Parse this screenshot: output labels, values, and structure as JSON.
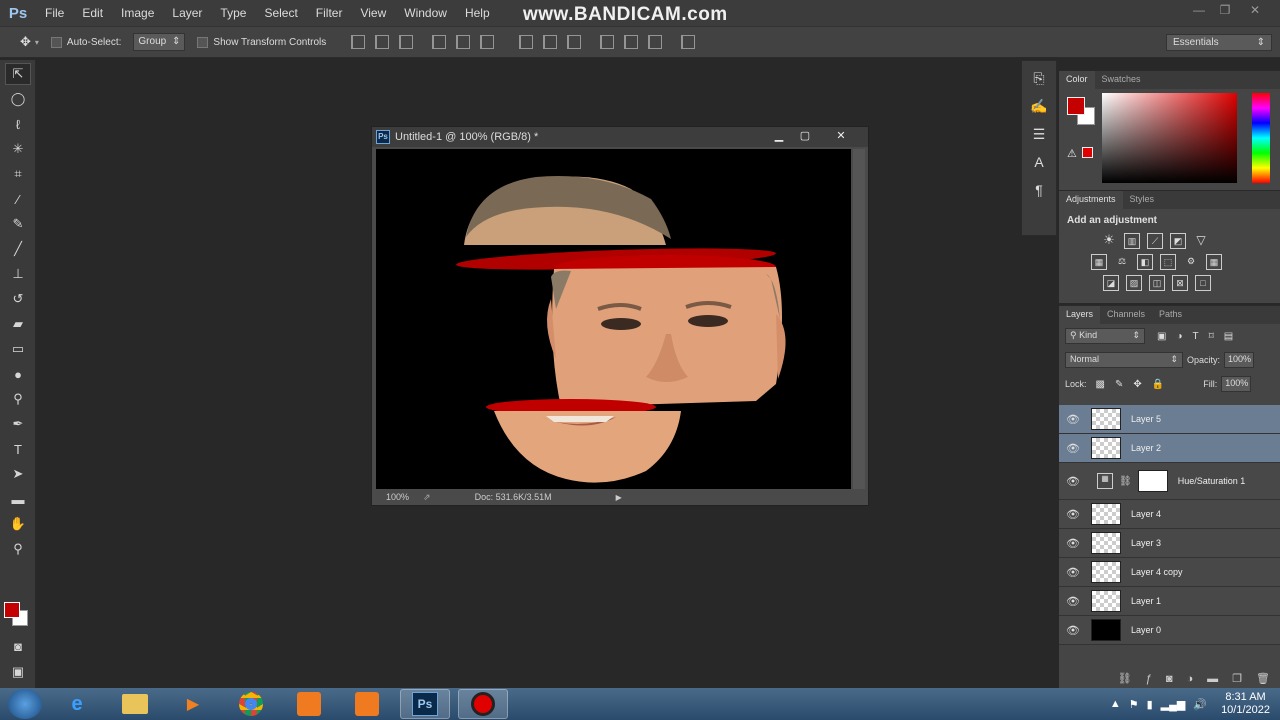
{
  "app": {
    "logo": "Ps",
    "menu": [
      "File",
      "Edit",
      "Image",
      "Layer",
      "Type",
      "Select",
      "Filter",
      "View",
      "Window",
      "Help"
    ],
    "watermark": "www.BANDICAM.com"
  },
  "options": {
    "move_icon": "move-tool-icon",
    "auto_select_label": "Auto-Select:",
    "auto_select_value": "Group",
    "transform_label": "Show Transform Controls",
    "workspace": "Essentials"
  },
  "tools": [
    "move-tool-icon",
    "elliptical-marquee-icon",
    "lasso-icon",
    "magic-wand-icon",
    "crop-icon",
    "eyedropper-icon",
    "spot-healing-icon",
    "brush-icon",
    "clone-stamp-icon",
    "history-brush-icon",
    "eraser-icon",
    "gradient-icon",
    "blur-icon",
    "dodge-icon",
    "pen-icon",
    "type-icon",
    "path-selection-icon",
    "rectangle-icon",
    "hand-icon",
    "zoom-icon"
  ],
  "colors": {
    "foreground": "#c40000",
    "background": "#ffffff",
    "accent": "#6a7d92"
  },
  "document": {
    "title": "Untitled-1 @ 100% (RGB/8) *",
    "zoom": "100%",
    "doc_info": "Doc: 531.6K/3.51M"
  },
  "color_panel": {
    "tabs": [
      "Color",
      "Swatches"
    ]
  },
  "adjustments_panel": {
    "tabs": [
      "Adjustments",
      "Styles"
    ],
    "title": "Add an adjustment"
  },
  "layers_panel": {
    "tabs": [
      "Layers",
      "Channels",
      "Paths"
    ],
    "kind_label": "Kind",
    "blend_mode": "Normal",
    "opacity_label": "Opacity:",
    "opacity_value": "100%",
    "lock_label": "Lock:",
    "fill_label": "Fill:",
    "fill_value": "100%",
    "layers": [
      {
        "name": "Layer 5",
        "selected": true
      },
      {
        "name": "Layer 2",
        "selected": true
      },
      {
        "name": "Hue/Saturation 1",
        "selected": false,
        "adjustment": true
      },
      {
        "name": "Layer 4",
        "selected": false
      },
      {
        "name": "Layer 3",
        "selected": false
      },
      {
        "name": "Layer 4 copy",
        "selected": false
      },
      {
        "name": "Layer 1",
        "selected": false
      },
      {
        "name": "Layer 0",
        "selected": false,
        "black": true
      }
    ]
  },
  "taskbar": {
    "apps": [
      "internet-explorer-icon",
      "file-explorer-icon",
      "media-player-icon",
      "chrome-icon",
      "app-icon",
      "camera-app-icon",
      "photoshop-icon",
      "record-icon"
    ],
    "ps_label": "Ps",
    "time": "8:31 AM",
    "date": "10/1/2022"
  }
}
